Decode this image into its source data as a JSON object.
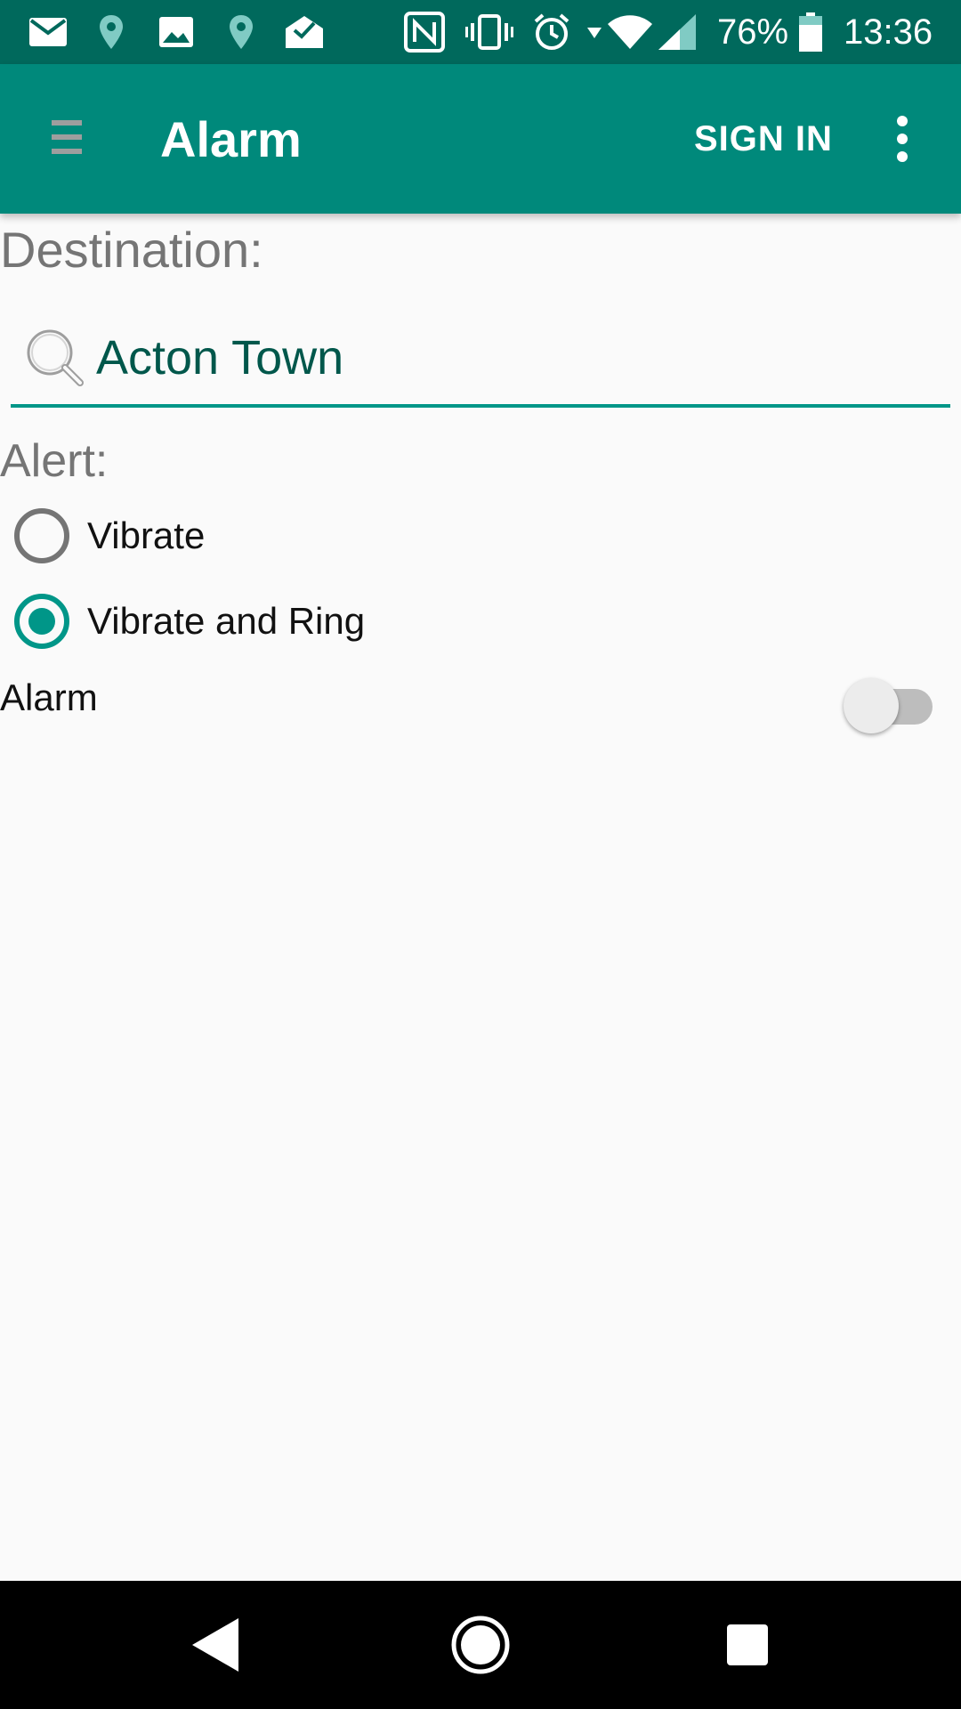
{
  "status_bar": {
    "battery_percent": "76%",
    "time": "13:36",
    "left_icons": [
      "mail-icon",
      "location-pin-icon",
      "image-icon",
      "location-pin-icon",
      "mail-opened-icon"
    ],
    "right_icons": [
      "nfc-icon",
      "vibrate-icon",
      "alarm-clock-icon",
      "wifi-icon",
      "cell-signal-icon",
      "battery-icon"
    ]
  },
  "app_bar": {
    "title": "Alarm",
    "sign_in_label": "SIGN IN",
    "menu_icon": "hamburger-menu-icon",
    "overflow_icon": "more-vert-icon"
  },
  "form": {
    "destination_label": "Destination:",
    "destination_value": "Acton Town",
    "alert_label": "Alert:",
    "alert_options": [
      {
        "label": "Vibrate",
        "checked": false
      },
      {
        "label": "Vibrate and Ring",
        "checked": true
      }
    ],
    "alarm_label": "Alarm",
    "alarm_enabled": false
  },
  "nav_bar": {
    "icons": [
      "back-icon",
      "home-icon",
      "recents-icon"
    ]
  },
  "colors": {
    "status_bar": "#00695c",
    "app_bar": "#00897b",
    "accent": "#009688",
    "text_value": "#00574b",
    "label_gray": "#757575"
  }
}
